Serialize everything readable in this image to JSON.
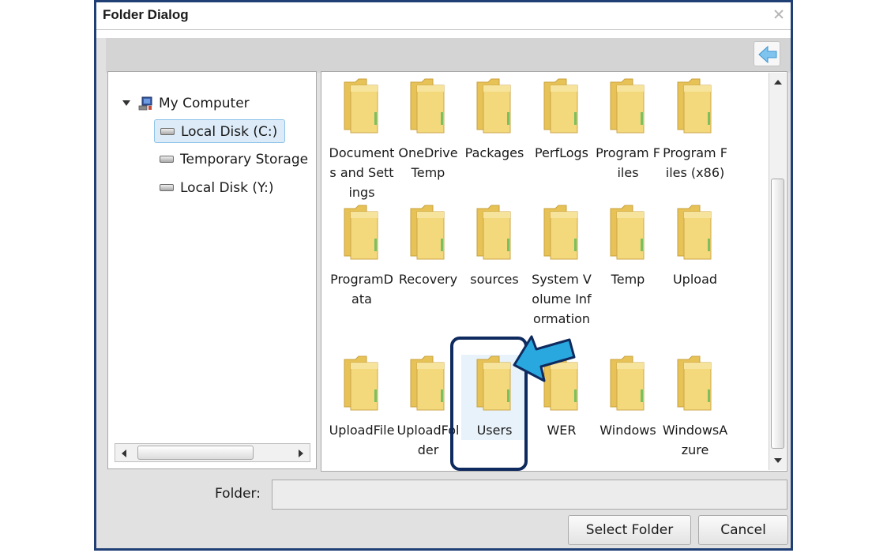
{
  "dialog": {
    "title": "Folder Dialog"
  },
  "tree": {
    "root_label": "My Computer",
    "items": [
      {
        "label": "Local Disk (C:)",
        "selected": true
      },
      {
        "label": "Temporary Storage",
        "selected": false
      },
      {
        "label": "Local Disk (Y:)",
        "selected": false
      }
    ]
  },
  "folders": [
    {
      "name": "Documents and Settings"
    },
    {
      "name": "OneDriveTemp"
    },
    {
      "name": "Packages"
    },
    {
      "name": "PerfLogs"
    },
    {
      "name": "Program Files"
    },
    {
      "name": "Program Files (x86)"
    },
    {
      "name": "ProgramData"
    },
    {
      "name": "Recovery"
    },
    {
      "name": "sources"
    },
    {
      "name": "System Volume Information"
    },
    {
      "name": "Temp"
    },
    {
      "name": "Upload"
    },
    {
      "name": "UploadFile"
    },
    {
      "name": "UploadFolder"
    },
    {
      "name": "Users",
      "highlighted": true
    },
    {
      "name": "WER"
    },
    {
      "name": "Windows"
    },
    {
      "name": "WindowsAzure"
    }
  ],
  "footer": {
    "folder_label": "Folder:",
    "folder_value": "",
    "select_button": "Select Folder",
    "cancel_button": "Cancel"
  },
  "colors": {
    "frame": "#1f3f75",
    "highlight_box": "#0e2a5e",
    "pointer": "#29a8e0",
    "folder": "#f3d97c"
  },
  "icons": [
    "close-icon",
    "back-arrow-icon",
    "expander-icon",
    "computer-icon",
    "drive-icon",
    "folder-icon",
    "pointer-arrow"
  ]
}
